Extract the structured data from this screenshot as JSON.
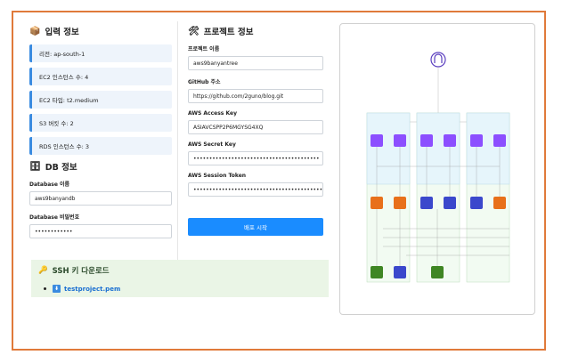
{
  "input_info": {
    "title": "입력 정보",
    "items": [
      "리전: ap-south-1",
      "EC2 인스턴스 수: 4",
      "EC2 타입: t2.medium",
      "S3 버킷 수: 2",
      "RDS 인스턴스 수: 3"
    ]
  },
  "db_info": {
    "title": "DB 정보",
    "name_label": "Database 이름",
    "name_value": "aws9banyandb",
    "password_label": "Database 비밀번호",
    "password_value": "••••••••••••"
  },
  "project_info": {
    "title": "프로젝트 정보",
    "project_name_label": "프로젝트 이름",
    "project_name_value": "aws9banyantree",
    "github_label": "GitHub 주소",
    "github_value": "https://github.com/2guno/blog.git",
    "access_key_label": "AWS Access Key",
    "access_key_value": "ASIAVCSPP2P6MGYSG4XQ",
    "secret_key_label": "AWS Secret Key",
    "secret_key_value": "••••••••••••••••••••••••••••••••••••••••",
    "session_token_label": "AWS Session Token",
    "session_token_value": "••••••••••••••••••••••••••••••••••••••••••••••••••••••••••••••••••••",
    "deploy_button": "배포 시작"
  },
  "ssh": {
    "title": "SSH 키 다운로드",
    "file_link": "testproject.pem"
  },
  "colors": {
    "accent": "#1a8cff",
    "frame": "#e07a3a",
    "info_bg": "#eef4fb",
    "ssh_bg": "#eaf5e6",
    "ec2": "#e8701a",
    "lambda": "#8c4fff",
    "s3": "#3f8624"
  }
}
